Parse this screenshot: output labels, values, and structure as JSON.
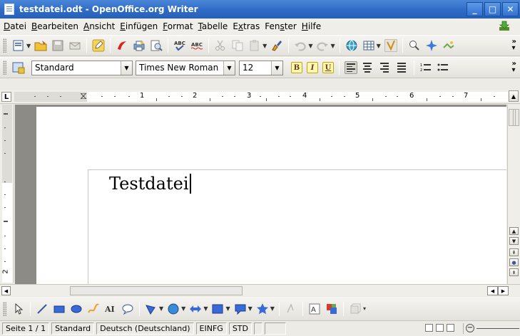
{
  "window": {
    "title": "testdatei.odt - OpenOffice.org Writer",
    "buttons": {
      "minimize": "_",
      "maximize": "□",
      "close": "✕"
    }
  },
  "menu": [
    {
      "label": "Datei",
      "mnemonic": "D",
      "rest": "atei"
    },
    {
      "label": "Bearbeiten",
      "mnemonic": "B",
      "rest": "earbeiten"
    },
    {
      "label": "Ansicht",
      "mnemonic": "A",
      "rest": "nsicht"
    },
    {
      "label": "Einfügen",
      "mnemonic": "E",
      "rest": "infügen"
    },
    {
      "label": "Format",
      "mnemonic": "F",
      "rest": "ormat"
    },
    {
      "label": "Tabelle",
      "mnemonic": "T",
      "rest": "abelle"
    },
    {
      "label": "Extras",
      "mnemonic": "x",
      "pre": "E",
      "rest": "tras"
    },
    {
      "label": "Fenster",
      "mnemonic": "s",
      "pre": "Fen",
      "rest": "ter"
    },
    {
      "label": "Hilfe",
      "mnemonic": "H",
      "rest": "ilfe"
    }
  ],
  "format_toolbar": {
    "paragraph_style": "Standard",
    "font_name": "Times New Roman",
    "font_size": "12",
    "bold_label": "B",
    "italic_label": "I",
    "underline_label": "U"
  },
  "ruler": {
    "numbers": [
      "1",
      "2",
      "3",
      "4",
      "5",
      "6",
      "7"
    ],
    "tab_selector": "L"
  },
  "vertical_ruler": {
    "number": "2"
  },
  "document": {
    "text": "Testdatei"
  },
  "statusbar": {
    "page": "Seite 1 / 1",
    "style": "Standard",
    "language": "Deutsch (Deutschland)",
    "insert_mode": "EINFG",
    "selection_mode": "STD"
  },
  "drawing_toolbar": {
    "fontwork_label": "AI"
  },
  "colors": {
    "titlebar": "#2f6bc4",
    "accent_yellow": "#fff7b8",
    "doc_background": "#8d8b85"
  }
}
